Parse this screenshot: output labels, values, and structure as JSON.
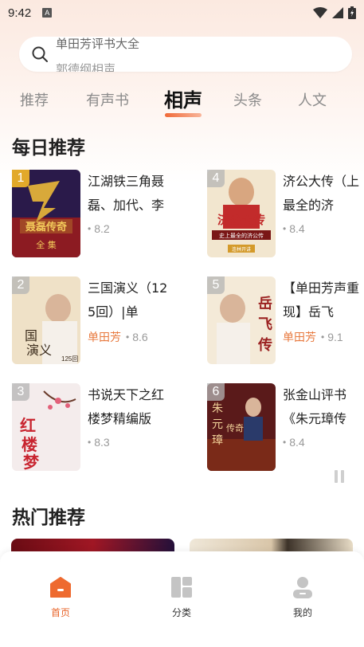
{
  "status": {
    "time": "9:42",
    "notif_icon": "A"
  },
  "search": {
    "placeholder": "单田芳评书大全",
    "next_placeholder": "郭德纲相声"
  },
  "tabs": [
    {
      "label": "推荐",
      "active": false
    },
    {
      "label": "有声书",
      "active": false
    },
    {
      "label": "相声",
      "active": true
    },
    {
      "label": "头条",
      "active": false
    },
    {
      "label": "人文",
      "active": false
    }
  ],
  "daily": {
    "title": "每日推荐",
    "items": [
      {
        "rank": "1",
        "title": "江湖铁三角聂磊、加代、李",
        "author": "",
        "score": "8.2",
        "cover_icon": "nie-lei-cover"
      },
      {
        "rank": "2",
        "title": "三国演义（125回）|单",
        "author": "单田芳",
        "score": "8.6",
        "cover_icon": "san-guo-cover"
      },
      {
        "rank": "3",
        "title": "书说天下之红楼梦精编版",
        "author": "",
        "score": "8.3",
        "cover_icon": "hong-lou-meng-cover"
      },
      {
        "rank": "4",
        "title": "济公大传（上最全的济",
        "author": "",
        "score": "8.4",
        "cover_icon": "ji-gong-cover"
      },
      {
        "rank": "5",
        "title": "【单田芳声重现】岳飞",
        "author": "单田芳",
        "score": "9.1",
        "cover_icon": "yue-fei-cover"
      },
      {
        "rank": "6",
        "title": "张金山评书《朱元璋传",
        "author": "",
        "score": "8.4",
        "cover_icon": "zhu-yuan-zhang-cover"
      }
    ]
  },
  "hot": {
    "title": "热门推荐"
  },
  "nav": [
    {
      "label": "首页",
      "icon": "home-icon",
      "active": true
    },
    {
      "label": "分类",
      "icon": "category-icon",
      "active": false
    },
    {
      "label": "我的",
      "icon": "profile-icon",
      "active": false
    }
  ],
  "colors": {
    "accent": "#e8652b",
    "rank_gold": "#e2a92a",
    "author": "#e87a3f"
  }
}
